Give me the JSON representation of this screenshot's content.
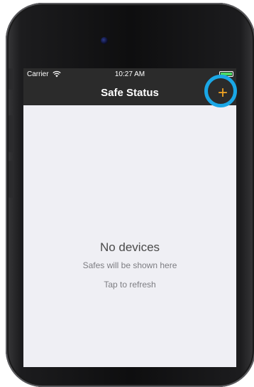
{
  "status_bar": {
    "carrier": "Carrier",
    "time": "10:27 AM",
    "battery_level": 1.0
  },
  "nav": {
    "title": "Safe Status",
    "add_label": "+"
  },
  "empty_state": {
    "title": "No devices",
    "subtitle": "Safes will be shown here",
    "refresh": "Tap to refresh"
  },
  "colors": {
    "accent": "#f5a623",
    "highlight": "#1aa7e6",
    "bar_background": "#2b2b2b",
    "screen_background": "#efeff4"
  },
  "icons": [
    "wifi-icon",
    "battery-icon",
    "plus-icon",
    "camera-icon"
  ]
}
